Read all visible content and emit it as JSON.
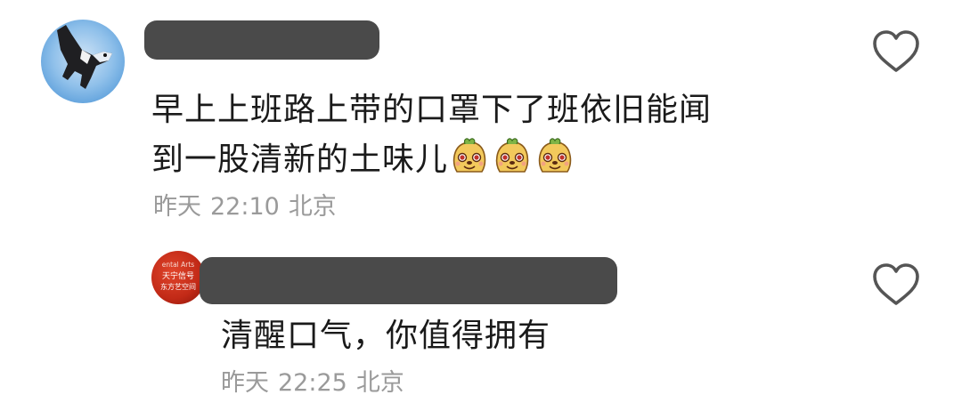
{
  "comments": [
    {
      "user": {
        "avatar": "cat-in-snow-avatar",
        "name_redacted": true
      },
      "text_lines": [
        "早上上班路上带的口罩下了班依旧能闻",
        "到一股清新的土味儿"
      ],
      "emojis": [
        "mole-smile-emoji",
        "mole-smile-emoji",
        "mole-smile-emoji"
      ],
      "date": "昨天",
      "time": "22:10",
      "location": "北京",
      "like_icon": "heart-outline-icon"
    },
    {
      "user": {
        "avatar": "red-logo-avatar",
        "avatar_text": [
          "ental Arts",
          "天宁信号",
          "东方艺空间"
        ],
        "name_redacted": true
      },
      "text": "清醒口气，你值得拥有",
      "date": "昨天",
      "time": "22:25",
      "location": "北京",
      "like_icon": "heart-outline-icon"
    }
  ],
  "colors": {
    "text": "#1a1a1a",
    "meta": "#9a9a9a",
    "redaction": "#4a4a4a",
    "heart_stroke": "#555555"
  }
}
